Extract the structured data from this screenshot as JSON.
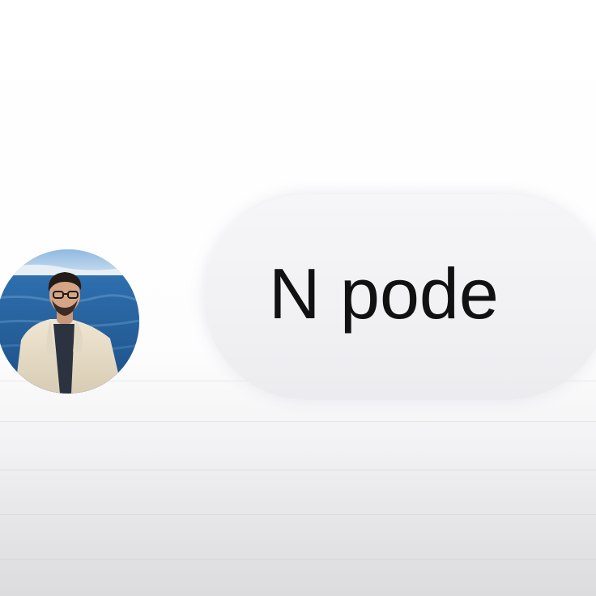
{
  "conversation": {
    "message": {
      "text": "N pode"
    },
    "avatar": {
      "icon": "profile-photo"
    }
  }
}
